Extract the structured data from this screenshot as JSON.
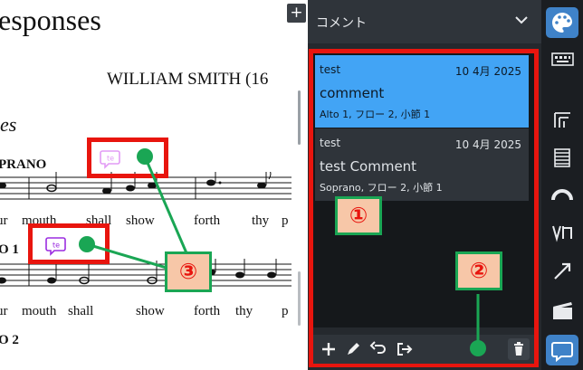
{
  "score": {
    "title": "esponses",
    "composer": "WILLIAM SMITH (16",
    "tempo": "es",
    "parts": [
      "PRANO",
      "O 1",
      "O 2"
    ],
    "lyrics_row1": [
      "ur",
      "mouth",
      "shall",
      "show",
      "forth",
      "thy",
      "p"
    ],
    "lyrics_row2": [
      "ur",
      "mouth",
      "shall",
      "show",
      "forth",
      "thy",
      "p"
    ],
    "comment_marks": [
      {
        "label": "te",
        "color": "#e29bf5"
      },
      {
        "label": "te",
        "color": "#9b2de0"
      }
    ],
    "add_label": "+"
  },
  "annotations": {
    "badge1": "①",
    "badge2": "②",
    "badge3": "③",
    "accent_red": "#e8150e",
    "accent_green": "#1aa654"
  },
  "panel": {
    "title": "コメント",
    "comments": [
      {
        "user": "test",
        "date": "10 4月 2025",
        "body": "comment",
        "location": "Alto 1, フロー 2, 小節 1",
        "selected": true
      },
      {
        "user": "test",
        "date": "10 4月 2025",
        "body": "test Comment",
        "location": "Soprano, フロー 2, 小節 1",
        "selected": false
      }
    ],
    "toolbar": [
      "plus-icon",
      "pencil-icon",
      "undo-icon",
      "export-icon",
      "trash-icon"
    ]
  },
  "rail": [
    "palette-icon",
    "keyboard-icon",
    "layout-icon",
    "staff-list-icon",
    "rainbow-icon",
    "voice-icon",
    "arrow-icon",
    "clapper-icon",
    "comment-icon"
  ]
}
